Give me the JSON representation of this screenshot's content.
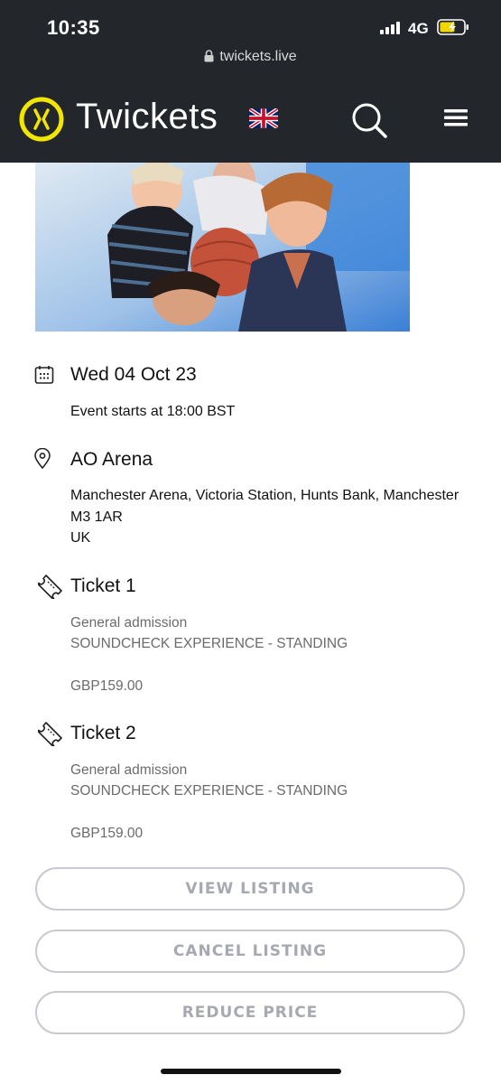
{
  "status_bar": {
    "time": "10:35",
    "network": "4G"
  },
  "browser": {
    "url": "twickets.live"
  },
  "header": {
    "brand": "Twickets",
    "accent_color": "#f2e600",
    "icons": [
      "twickets-logo-icon",
      "uk-flag-icon",
      "search-icon",
      "hamburger-menu-icon"
    ]
  },
  "event": {
    "date": "Wed 04 Oct 23",
    "start_time": "Event starts at 18:00 BST",
    "venue": "AO Arena",
    "address_line1": "Manchester Arena, Victoria Station, Hunts Bank, Manchester",
    "address_line2": "M3 1AR",
    "address_line3": "UK"
  },
  "tickets": [
    {
      "title": "Ticket 1",
      "admission": "General admission",
      "type": "SOUNDCHECK EXPERIENCE - STANDING",
      "price": "GBP159.00"
    },
    {
      "title": "Ticket 2",
      "admission": "General admission",
      "type": "SOUNDCHECK EXPERIENCE - STANDING",
      "price": "GBP159.00"
    }
  ],
  "actions": {
    "view_listing": "VIEW LISTING",
    "cancel_listing": "CANCEL LISTING",
    "reduce_price": "REDUCE PRICE"
  }
}
